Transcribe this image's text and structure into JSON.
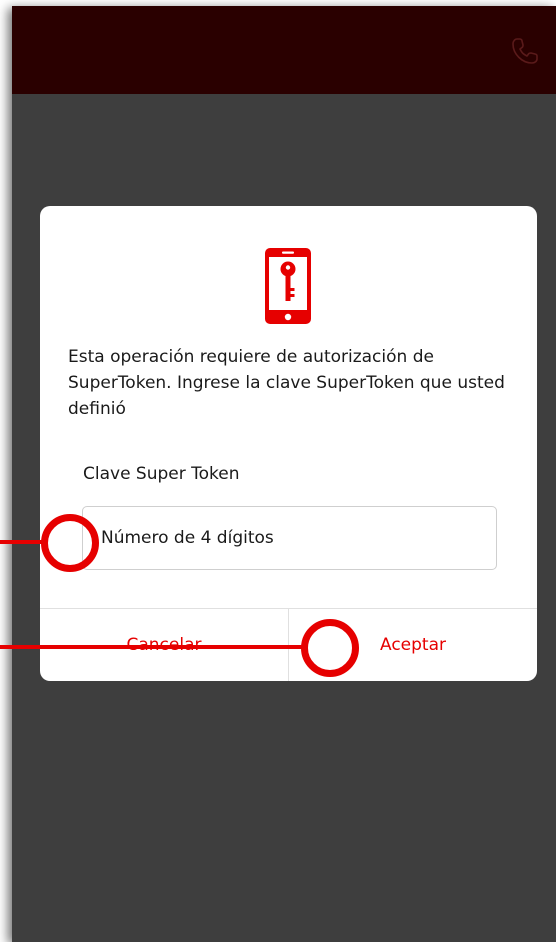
{
  "topbar": {
    "background": "#2a0000",
    "call_icon": "phone-handset-icon"
  },
  "dialog": {
    "icon": "mobile-key-icon",
    "message": "Esta operación requiere de autorización de SuperToken. Ingrese la clave SuperToken que usted definió",
    "field_label": "Clave Super Token",
    "input_value": "",
    "input_placeholder": "Número de 4 dígitos",
    "cancel_label": "Cancelar",
    "accept_label": "Aceptar"
  },
  "annotations": {
    "color": "#e60000"
  },
  "colors": {
    "accent": "#e60000",
    "overlay": "#3e3e3e"
  }
}
